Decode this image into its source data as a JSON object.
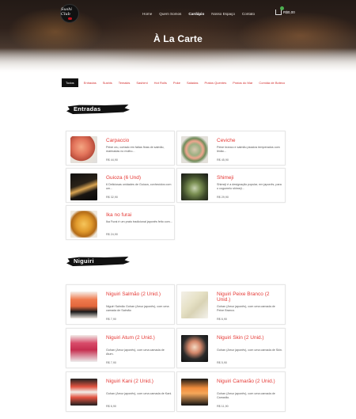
{
  "header": {
    "logo_text": "Sushi Club",
    "nav": [
      "Home",
      "Quem Somos",
      "Cardápio",
      "Nosso Espaço",
      "Contato"
    ],
    "active_nav": "Cardápio",
    "cart_total": "R$0,00",
    "page_title": "À La Carte"
  },
  "filters": [
    "Todos",
    "Entradas",
    "Sushis",
    "Temakis",
    "Sashimi",
    "Hot Rolls",
    "Poke",
    "Saladas",
    "Pratos Quentes",
    "Pratos do Mar",
    "Comida de Boteco"
  ],
  "sections": {
    "entradas": "Entradas",
    "niguiri": "Niguiri"
  },
  "entradas": [
    {
      "title": "Carpaccio",
      "desc": "Peixe cru, cortado em fatias finas de salmão, marinadas no molho...",
      "price": "R$ 44,90",
      "thumb": "carpaccio"
    },
    {
      "title": "Ceviche",
      "desc": "Peixe branco e salmão picados temperados com limão...",
      "price": "R$ 45,90",
      "thumb": "ceviche"
    },
    {
      "title": "Guioza (6 Und)",
      "desc": "6 Deliciosas unidades de Guioza, conhecidos com um...",
      "price": "R$ 32,90",
      "thumb": "guioza"
    },
    {
      "title": "Shimeji",
      "desc": "Shimeji é a designação popular, em japonês, para o cogumelo shimeji...",
      "price": "R$ 29,90",
      "thumb": "shimeji"
    },
    {
      "title": "Ika no furai",
      "desc": "Ika Furai é um prato tradicional japonês feito com...",
      "price": "R$ 24,90",
      "thumb": "ika"
    }
  ],
  "niguiri": [
    {
      "title": "Niguiri Salmão (2 Unid.)",
      "desc": "Niguiri Salmão Gohan (Arroz japonês), com uma camada de Salmão",
      "price": "R$ 7,90",
      "thumb": "salmao"
    },
    {
      "title": "Niguiri Peixe Branco (2 Unid.)",
      "desc": "Gohan (Arroz japonês), com uma camada de Peixe Branco.",
      "price": "R$ 6,90",
      "thumb": "peixe"
    },
    {
      "title": "Niguiri Atum (2 Unid.)",
      "desc": "Gohan (Arroz japonês), com uma camada de Atum.",
      "price": "R$ 7,90",
      "thumb": "atum"
    },
    {
      "title": "Niguiri Skin (2 Unid.)",
      "desc": "Gohan (Arroz japonês), com uma camada de Skin.",
      "price": "R$ 5,90",
      "thumb": "skin"
    },
    {
      "title": "Niguiri Kani (2 Unid.)",
      "desc": "Gohan (Arroz japonês), com uma camada de Kani.",
      "price": "R$ 6,90",
      "thumb": "kani"
    },
    {
      "title": "Niguiri Camarão (2 Unid.)",
      "desc": "Gohan (Arroz japonês), com uma camada de Camarão.",
      "price": "R$ 11,90",
      "thumb": "camarao"
    }
  ],
  "colors": {
    "accent": "#e53935",
    "filter_active_bg": "#111111",
    "cart_badge": "#4caf50"
  }
}
